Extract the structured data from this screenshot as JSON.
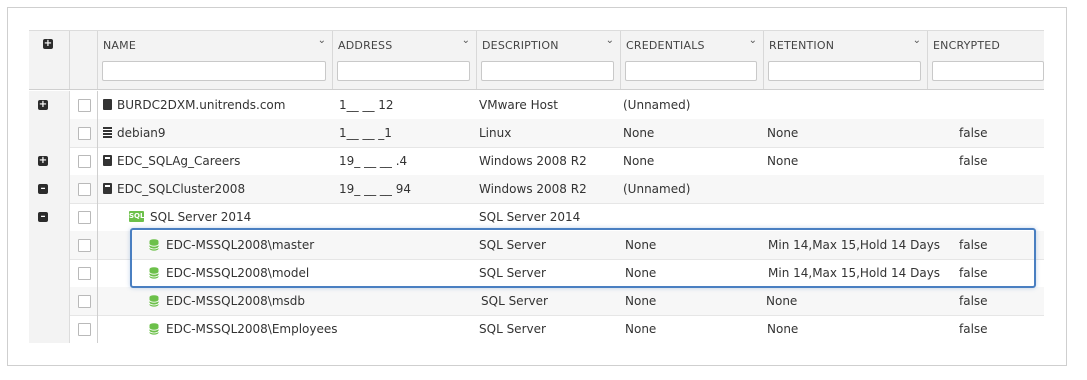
{
  "columns": {
    "name": "NAME",
    "address": "ADDRESS",
    "description": "DESCRIPTION",
    "credentials": "CREDENTIALS",
    "retention": "RETENTION",
    "encrypted": "ENCRYPTED"
  },
  "rows": [
    {
      "expander": "plus",
      "icon": "vmware-host-icon",
      "name": "BURDC2DXM.unitrends.com",
      "address": "1__ __ 12",
      "description": "VMware Host",
      "credentials": "(Unnamed)",
      "retention": "",
      "encrypted": ""
    },
    {
      "expander": "",
      "icon": "linux-server-icon",
      "name": "debian9",
      "address": "1__ __ _1",
      "description": "Linux",
      "credentials": "None",
      "retention": "None",
      "encrypted": "false"
    },
    {
      "expander": "plus",
      "icon": "windows-server-icon",
      "name": "EDC_SQLAg_Careers",
      "address": "19_ __ __ .4",
      "description": "Windows 2008 R2",
      "credentials": "None",
      "retention": "None",
      "encrypted": "false"
    },
    {
      "expander": "minus",
      "icon": "windows-server-icon",
      "name": "EDC_SQLCluster2008",
      "address": "19_ __ __ 94",
      "description": "Windows 2008 R2",
      "credentials": "(Unnamed)",
      "retention": "",
      "encrypted": ""
    },
    {
      "expander": "minus",
      "icon": "sql-instance-icon",
      "name": "SQL Server 2014",
      "address": "",
      "description": "SQL Server 2014",
      "credentials": "",
      "retention": "",
      "encrypted": ""
    },
    {
      "expander": "",
      "icon": "database-icon",
      "name": "EDC-MSSQL2008\\master",
      "address": "",
      "description": "SQL Server",
      "credentials": "None",
      "retention": "Min 14,Max 15,Hold 14 Days",
      "encrypted": "false"
    },
    {
      "expander": "",
      "icon": "database-icon",
      "name": "EDC-MSSQL2008\\model",
      "address": "",
      "description": "SQL Server",
      "credentials": "None",
      "retention": "Min 14,Max 15,Hold 14 Days",
      "encrypted": "false"
    },
    {
      "expander": "",
      "icon": "database-icon",
      "name": "EDC-MSSQL2008\\msdb",
      "address": "",
      "description": "SQL Server",
      "credentials": "None",
      "retention": "None",
      "encrypted": "false"
    },
    {
      "expander": "",
      "icon": "database-icon",
      "name": "EDC-MSSQL2008\\Employees",
      "address": "",
      "description": "SQL Server",
      "credentials": "None",
      "retention": "None",
      "encrypted": "false"
    }
  ],
  "sql_badge": "SQL",
  "colors": {
    "highlight": "#4a7fc1",
    "sql_green": "#6cc04a"
  }
}
